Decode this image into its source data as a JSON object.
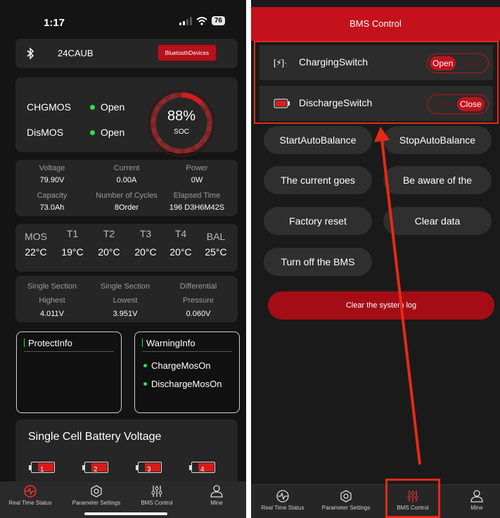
{
  "left": {
    "status": {
      "time": "1:17",
      "battery": "76"
    },
    "bluetooth": {
      "device_name": "24CAUB",
      "button_label": "BluetoothDevices"
    },
    "mos": {
      "charge": {
        "label": "CHGMOS",
        "state": "Open"
      },
      "discharge": {
        "label": "DisMOS",
        "state": "Open"
      },
      "soc_value": "88%",
      "soc_fraction": 0.88,
      "soc_label": "SOC"
    },
    "stats": [
      {
        "label": "Voltage",
        "value": "79.90V"
      },
      {
        "label": "Current",
        "value": "0.00A"
      },
      {
        "label": "Power",
        "value": "0W"
      },
      {
        "label": "Capacity",
        "value": "73.0Ah"
      },
      {
        "label": "Number of Cycles",
        "value": "8Order"
      },
      {
        "label": "Elapsed Time",
        "value": "196 D3H6M42S"
      }
    ],
    "temps": [
      {
        "label": "MOS",
        "value": "22°C"
      },
      {
        "label": "T1",
        "value": "19°C"
      },
      {
        "label": "T2",
        "value": "20°C"
      },
      {
        "label": "T3",
        "value": "20°C"
      },
      {
        "label": "T4",
        "value": "20°C"
      },
      {
        "label": "BAL",
        "value": "25°C"
      }
    ],
    "cells": {
      "col1": {
        "line1": "Single Section",
        "line2": "Highest",
        "value": "4.011V"
      },
      "col2": {
        "line1": "Single Section",
        "line2": "Lowest",
        "value": "3.951V"
      },
      "col3": {
        "line1": "Differential",
        "line2": "Pressure",
        "value": "0.060V"
      }
    },
    "protect_info": {
      "title": "ProtectInfo"
    },
    "warning_info": {
      "title": "WarningInfo",
      "items": [
        "ChargeMosOn",
        "DischargeMosOn"
      ]
    },
    "cell_voltage": {
      "title": "Single Cell Battery Voltage",
      "cells": [
        "1",
        "2",
        "3",
        "4"
      ]
    },
    "tabs": [
      "Real Time Status",
      "Parameter Settings",
      "BMS Control",
      "Mine"
    ]
  },
  "right": {
    "header": "BMS Control",
    "charging": {
      "label": "ChargingSwitch",
      "open": "Open",
      "close": "Close",
      "selected": "Open"
    },
    "discharge": {
      "label": "DischargeSwitch",
      "open": "Open",
      "close": "Close",
      "selected": "Close"
    },
    "buttons": {
      "start_balance": "StartAutoBalance",
      "stop_balance": "StopAutoBalance",
      "current_goes": "The current goes",
      "be_aware": "Be aware of the",
      "factory_reset": "Factory reset",
      "clear_data": "Clear data",
      "turn_off": "Turn off the BMS",
      "clear_log": "Clear the system log"
    },
    "tabs": [
      "Real Time Status",
      "Parameter Settings",
      "BMS Control",
      "Mine"
    ]
  },
  "colors": {
    "accent": "#c4121c",
    "ok": "#2ee24b",
    "annotation": "#e42a16"
  }
}
